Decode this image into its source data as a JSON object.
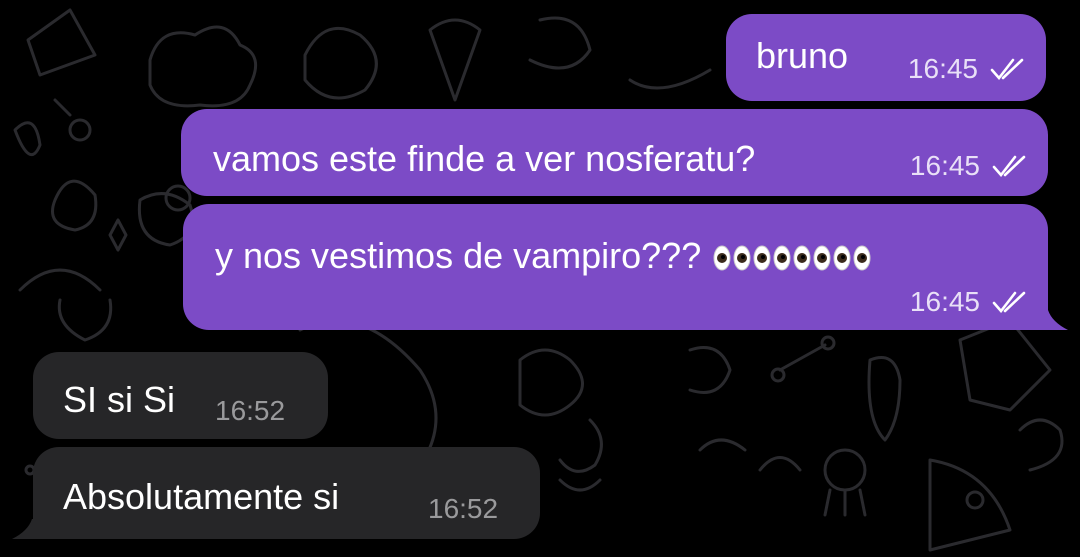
{
  "chat": {
    "messages": [
      {
        "direction": "outgoing",
        "text": "bruno",
        "time": "16:45",
        "status_icon": "double-check-icon"
      },
      {
        "direction": "outgoing",
        "text": "vamos este finde a ver nosferatu?",
        "time": "16:45",
        "status_icon": "double-check-icon"
      },
      {
        "direction": "outgoing",
        "text": "y nos vestimos de vampiro???",
        "emoji": "eyes-emoji",
        "emoji_count": 8,
        "time": "16:45",
        "status_icon": "double-check-icon"
      },
      {
        "direction": "incoming",
        "text": "SI si Si",
        "time": "16:52"
      },
      {
        "direction": "incoming",
        "text": "Absolutamente si",
        "time": "16:52"
      }
    ]
  },
  "colors": {
    "background": "#000000",
    "outgoing_bubble": "#7c4bc6",
    "incoming_bubble": "#262628",
    "text": "#ffffff",
    "incoming_time": "#9a9a9c",
    "wallpaper_doodles": "#2a2a2e"
  }
}
